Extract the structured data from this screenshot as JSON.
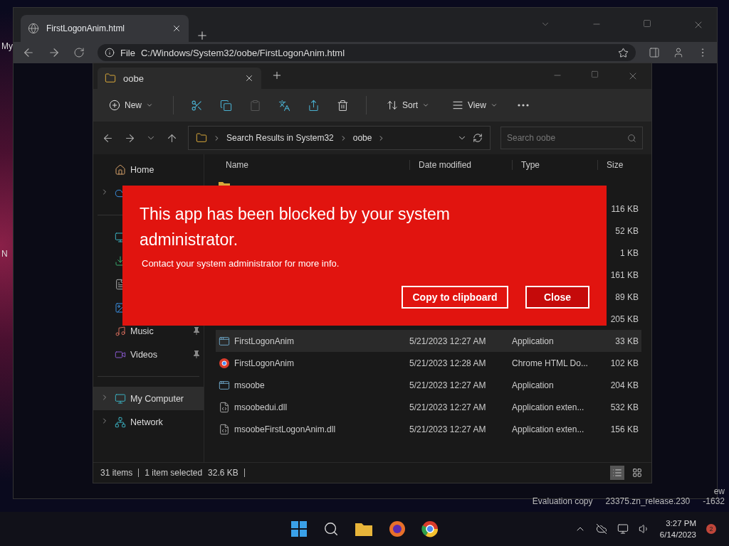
{
  "desktop": {
    "icon_labels": [
      "My",
      "N"
    ],
    "watermark_top": "ew",
    "watermark": [
      "Evaluation copy",
      "23375.zn_release.230",
      "-1632"
    ]
  },
  "browser": {
    "tab_title": "FirstLogonAnim.html",
    "scheme_label": "File",
    "url": "C:/Windows/System32/oobe/FirstLogonAnim.html"
  },
  "explorer": {
    "tab_title": "oobe",
    "toolbar": {
      "new_label": "New",
      "sort_label": "Sort",
      "view_label": "View"
    },
    "breadcrumb": [
      "Search Results in System32",
      "oobe"
    ],
    "search": {
      "placeholder": "Search oobe"
    },
    "columns": [
      "Name",
      "Date modified",
      "Type",
      "Size"
    ],
    "sidebar": [
      {
        "kind": "home",
        "label": "Home",
        "expandable": false,
        "pinned": false,
        "selected": false,
        "divider_before": false
      },
      {
        "kind": "cloud",
        "expandable": true,
        "selected": false,
        "divider_before": false
      },
      {
        "kind": "desktop",
        "expandable": false,
        "selected": false,
        "divider_before": true
      },
      {
        "kind": "downloads",
        "expandable": false,
        "selected": false,
        "divider_before": false
      },
      {
        "kind": "documents",
        "expandable": false,
        "selected": false,
        "divider_before": false
      },
      {
        "kind": "pictures",
        "expandable": false,
        "selected": false,
        "divider_before": false
      },
      {
        "kind": "music",
        "label": "Music",
        "expandable": false,
        "pinned": true,
        "selected": false,
        "divider_before": false
      },
      {
        "kind": "videos",
        "label": "Videos",
        "expandable": false,
        "pinned": true,
        "selected": false,
        "divider_before": false
      },
      {
        "kind": "computer",
        "label": "My Computer",
        "expandable": true,
        "pinned": false,
        "selected": true,
        "divider_before": true
      },
      {
        "kind": "network",
        "label": "Network",
        "expandable": true,
        "pinned": false,
        "selected": false,
        "divider_before": false
      }
    ],
    "rows": [
      {
        "kind": "folder",
        "selected": false
      },
      {
        "kind": "file",
        "size": "116 KB",
        "selected": false
      },
      {
        "kind": "file",
        "size": "52 KB",
        "selected": false
      },
      {
        "kind": "file",
        "size": "1 KB",
        "selected": false
      },
      {
        "kind": "file",
        "size": "161 KB",
        "selected": false
      },
      {
        "kind": "file",
        "size": "89 KB",
        "selected": false
      },
      {
        "kind": "file",
        "size": "205 KB",
        "selected": false
      },
      {
        "kind": "app",
        "name": "FirstLogonAnim",
        "date": "5/21/2023 12:27 AM",
        "type": "Application",
        "size": "33 KB",
        "selected": true
      },
      {
        "kind": "chrome",
        "name": "FirstLogonAnim",
        "date": "5/21/2023 12:28 AM",
        "type": "Chrome HTML Do...",
        "size": "102 KB",
        "selected": false
      },
      {
        "kind": "app",
        "name": "msoobe",
        "date": "5/21/2023 12:27 AM",
        "type": "Application",
        "size": "204 KB",
        "selected": false
      },
      {
        "kind": "dll",
        "name": "msoobedui.dll",
        "date": "5/21/2023 12:27 AM",
        "type": "Application exten...",
        "size": "532 KB",
        "selected": false
      },
      {
        "kind": "dll",
        "name": "msoobeFirstLogonAnim.dll",
        "date": "5/21/2023 12:27 AM",
        "type": "Application exten...",
        "size": "156 KB",
        "selected": false
      }
    ],
    "status": {
      "count": "31 items",
      "selection": "1 item selected",
      "selection_size": "32.6 KB"
    },
    "views": [
      {
        "kind": "details",
        "selected": true
      },
      {
        "kind": "tiles",
        "selected": false
      }
    ]
  },
  "dialog": {
    "title": "This app has been blocked by your system administrator.",
    "message": "Contact your system administrator for more info.",
    "buttons": [
      {
        "label": "Copy to clipboard",
        "kind": "outline"
      },
      {
        "label": "Close",
        "kind": "filled"
      }
    ]
  },
  "taskbar": {
    "time": "3:27 PM",
    "date": "6/14/2023",
    "badge": "2"
  }
}
